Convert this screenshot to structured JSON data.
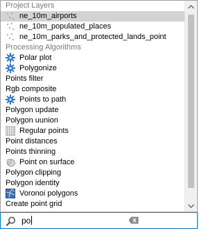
{
  "project_layers": {
    "header": "Project Layers",
    "items": [
      {
        "label": "ne_10m_airports",
        "icon": "point-layer-icon",
        "selected": true
      },
      {
        "label": "ne_10m_populated_places",
        "icon": "point-layer-icon"
      },
      {
        "label": "ne_10m_parks_and_protected_lands_point",
        "icon": "point-layer-icon"
      }
    ]
  },
  "processing_algorithms": {
    "header": "Processing Algorithms",
    "items": [
      {
        "label": "Polar plot",
        "icon": "gear-icon"
      },
      {
        "label": "Polygonize",
        "icon": "gear-icon"
      },
      {
        "label": "Points filter"
      },
      {
        "label": "Rgb composite"
      },
      {
        "label": "Points to path",
        "icon": "gear-icon"
      },
      {
        "label": "Polygon update"
      },
      {
        "label": "Polygon uunion"
      },
      {
        "label": "Regular points",
        "icon": "grid-icon"
      },
      {
        "label": "Point distances"
      },
      {
        "label": "Points thinning"
      },
      {
        "label": "Point on surface",
        "icon": "point-on-surface-icon"
      },
      {
        "label": "Polygon clipping"
      },
      {
        "label": "Polygon identity"
      },
      {
        "label": "Voronoi polygons",
        "icon": "voronoi-icon"
      },
      {
        "label": "Create point grid"
      }
    ]
  },
  "search": {
    "value": "po"
  },
  "colors": {
    "selection": "#d4d4d4",
    "header_text": "#7a7a7a",
    "gear_blue": "#2f7ad0",
    "focus_border": "#0078d7"
  }
}
